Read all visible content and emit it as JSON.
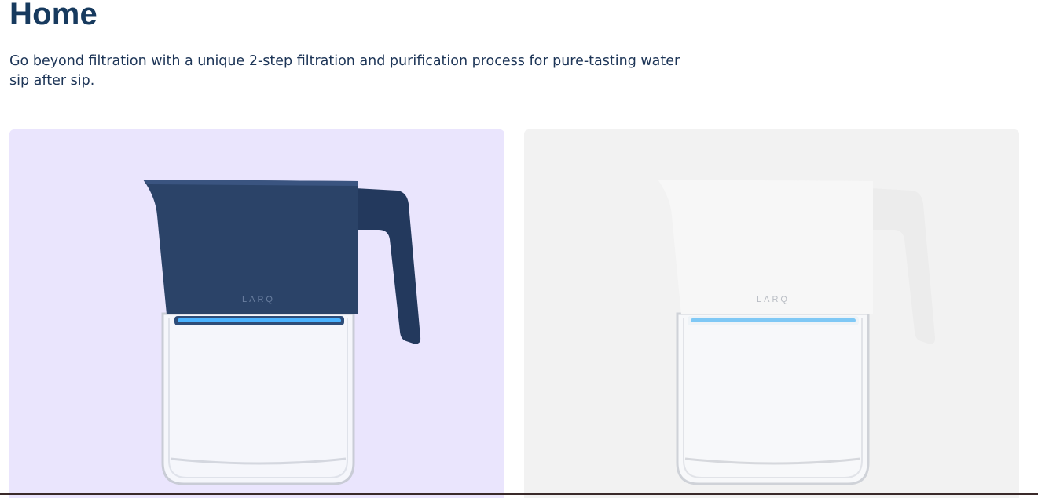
{
  "page": {
    "title": "Home",
    "description": "Go beyond filtration with a unique 2-step filtration and purification process for pure-tasting water sip after sip."
  },
  "products": [
    {
      "brand": "LARQ",
      "colors": {
        "background": "#eae5fd",
        "top": "#2b4368",
        "glass": "#e9edf3",
        "light": "#4ab3ff"
      }
    },
    {
      "brand": "LARQ",
      "colors": {
        "background": "#f2f2f2",
        "top": "#f4f4f4",
        "glass": "#e9edf3",
        "light": "#7fc8f5"
      }
    }
  ]
}
